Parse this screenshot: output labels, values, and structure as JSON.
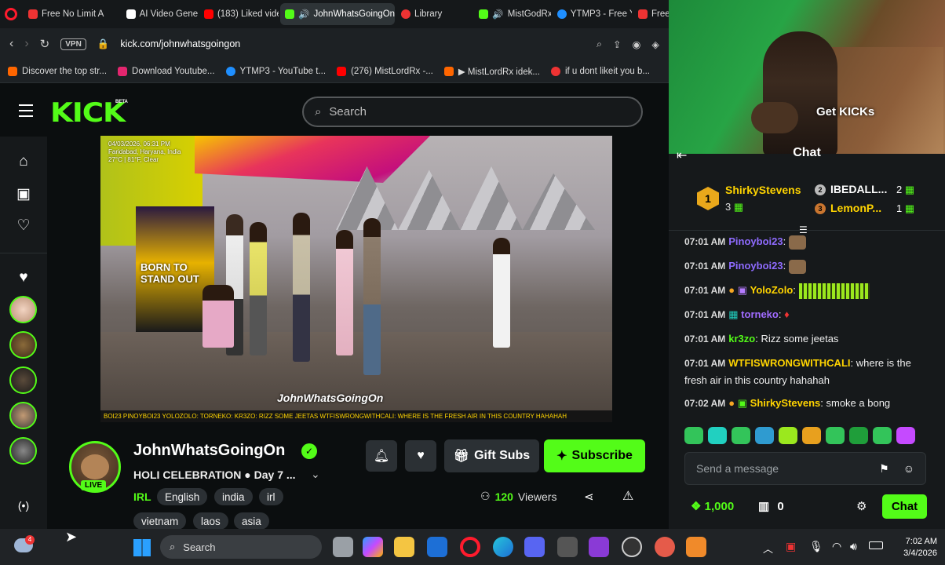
{
  "browser": {
    "tabs": [
      {
        "label": "Free No Limit A",
        "color": "#e33"
      },
      {
        "label": "AI Video Gener",
        "color": "#fff"
      },
      {
        "label": "(183) Liked vide",
        "color": "#f00"
      },
      {
        "label": "JohnWhatsGoingOn",
        "color": "#53fc18",
        "active": true
      },
      {
        "label": "Library",
        "color": "#e33"
      },
      {
        "label": "MistGodRx",
        "color": "#53fc18"
      },
      {
        "label": "YTMP3 - Free Y",
        "color": "#1f8fff"
      },
      {
        "label": "Free No Limit",
        "color": "#e33"
      }
    ],
    "url": "kick.com/johnwhatsgoingon",
    "vpn_label": "VPN",
    "bookmarks": [
      {
        "label": "Discover the top str...",
        "color": "#f60"
      },
      {
        "label": "Download Youtube...",
        "color": "#e3266f"
      },
      {
        "label": "YTMP3 - YouTube t...",
        "color": "#1f8fff"
      },
      {
        "label": "(276) MistLordRx -...",
        "color": "#f00"
      },
      {
        "label": "▶ MistLordRx idek...",
        "color": "#f60"
      },
      {
        "label": "if u dont likeit you b...",
        "color": "#e33"
      }
    ]
  },
  "kick": {
    "logo": "KICK",
    "beta": "BETA",
    "search_placeholder": "Search"
  },
  "video": {
    "overlay_top": "04/03/2026, 06:31 PM\nFaridabad, Haryana, India\n27°C | 81°F, Clear",
    "poster_text": "BORN TO STAND OUT",
    "brand": "JohnWhatsGoingOn",
    "caption": "BOI23  PINOYBOI23  YOLOZOLO:   TORNEKO:   KR3ZO: RIZZ SOME JEETAS  WTFISWRONGWITHCALI: WHERE IS THE FRESH AIR IN THIS COUNTRY HAHAHAH"
  },
  "channel": {
    "name": "JohnWhatsGoingOn",
    "live_label": "LIVE",
    "stream_title": "HOLI CELEBRATION ● Day 7 ...",
    "category": "IRL",
    "tags": [
      "English",
      "india",
      "irl",
      "vietnam",
      "laos",
      "asia"
    ],
    "gift_label": "Gift Subs",
    "subscribe_label": "Subscribe",
    "viewers_count": "120",
    "viewers_label": "Viewers"
  },
  "cam": {
    "overlay_text": "Get KICKs"
  },
  "chat": {
    "title": "Chat",
    "leaders": [
      {
        "rank": "1",
        "name": "ShirkyStevens",
        "count": "3"
      },
      {
        "rank": "2",
        "name": "IBEDALL...",
        "count": "2"
      },
      {
        "rank": "3",
        "name": "LemonP...",
        "count": "1"
      }
    ],
    "messages": [
      {
        "time": "07:01 AM",
        "user": "Pinoyboi23",
        "color": "#8f6bff",
        "text": ""
      },
      {
        "time": "07:01 AM",
        "user": "Pinoyboi23",
        "color": "#8f6bff",
        "text": ""
      },
      {
        "time": "07:01 AM",
        "user": "YoloZolo",
        "color": "#ffd400",
        "text": ""
      },
      {
        "time": "07:01 AM",
        "user": "torneko",
        "color": "#a06bff",
        "text": ""
      },
      {
        "time": "07:01 AM",
        "user": "kr3zo",
        "color": "#53fc18",
        "text": "Rizz some jeetas"
      },
      {
        "time": "07:01 AM",
        "user": "WTFISWRONGWITHCALI",
        "color": "#ffd400",
        "text": "where is the fresh air in this country hahahah"
      },
      {
        "time": "07:02 AM",
        "user": "ShirkyStevens",
        "color": "#ffd400",
        "text": "smoke a bong"
      }
    ],
    "input_placeholder": "Send a message",
    "kicks_balance": "1,000",
    "gift_count": "0",
    "send_label": "Chat"
  },
  "taskbar": {
    "search_label": "Search",
    "time": "7:02 AM",
    "date": "3/4/2026",
    "notify_count": "4"
  }
}
